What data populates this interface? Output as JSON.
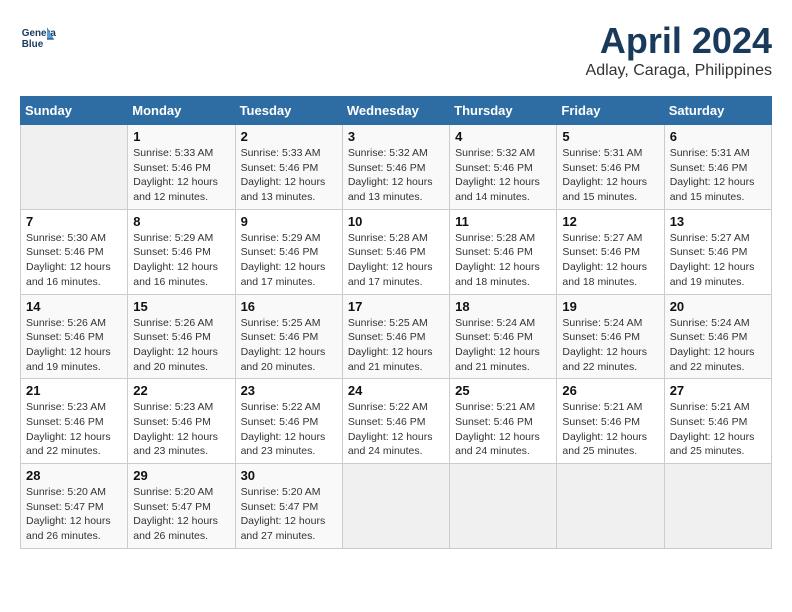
{
  "header": {
    "logo_line1": "General",
    "logo_line2": "Blue",
    "month_year": "April 2024",
    "location": "Adlay, Caraga, Philippines"
  },
  "weekdays": [
    "Sunday",
    "Monday",
    "Tuesday",
    "Wednesday",
    "Thursday",
    "Friday",
    "Saturday"
  ],
  "weeks": [
    [
      {
        "day": null
      },
      {
        "day": "1",
        "sunrise": "5:33 AM",
        "sunset": "5:46 PM",
        "daylight": "12 hours and 12 minutes."
      },
      {
        "day": "2",
        "sunrise": "5:33 AM",
        "sunset": "5:46 PM",
        "daylight": "12 hours and 13 minutes."
      },
      {
        "day": "3",
        "sunrise": "5:32 AM",
        "sunset": "5:46 PM",
        "daylight": "12 hours and 13 minutes."
      },
      {
        "day": "4",
        "sunrise": "5:32 AM",
        "sunset": "5:46 PM",
        "daylight": "12 hours and 14 minutes."
      },
      {
        "day": "5",
        "sunrise": "5:31 AM",
        "sunset": "5:46 PM",
        "daylight": "12 hours and 15 minutes."
      },
      {
        "day": "6",
        "sunrise": "5:31 AM",
        "sunset": "5:46 PM",
        "daylight": "12 hours and 15 minutes."
      }
    ],
    [
      {
        "day": "7",
        "sunrise": "5:30 AM",
        "sunset": "5:46 PM",
        "daylight": "12 hours and 16 minutes."
      },
      {
        "day": "8",
        "sunrise": "5:29 AM",
        "sunset": "5:46 PM",
        "daylight": "12 hours and 16 minutes."
      },
      {
        "day": "9",
        "sunrise": "5:29 AM",
        "sunset": "5:46 PM",
        "daylight": "12 hours and 17 minutes."
      },
      {
        "day": "10",
        "sunrise": "5:28 AM",
        "sunset": "5:46 PM",
        "daylight": "12 hours and 17 minutes."
      },
      {
        "day": "11",
        "sunrise": "5:28 AM",
        "sunset": "5:46 PM",
        "daylight": "12 hours and 18 minutes."
      },
      {
        "day": "12",
        "sunrise": "5:27 AM",
        "sunset": "5:46 PM",
        "daylight": "12 hours and 18 minutes."
      },
      {
        "day": "13",
        "sunrise": "5:27 AM",
        "sunset": "5:46 PM",
        "daylight": "12 hours and 19 minutes."
      }
    ],
    [
      {
        "day": "14",
        "sunrise": "5:26 AM",
        "sunset": "5:46 PM",
        "daylight": "12 hours and 19 minutes."
      },
      {
        "day": "15",
        "sunrise": "5:26 AM",
        "sunset": "5:46 PM",
        "daylight": "12 hours and 20 minutes."
      },
      {
        "day": "16",
        "sunrise": "5:25 AM",
        "sunset": "5:46 PM",
        "daylight": "12 hours and 20 minutes."
      },
      {
        "day": "17",
        "sunrise": "5:25 AM",
        "sunset": "5:46 PM",
        "daylight": "12 hours and 21 minutes."
      },
      {
        "day": "18",
        "sunrise": "5:24 AM",
        "sunset": "5:46 PM",
        "daylight": "12 hours and 21 minutes."
      },
      {
        "day": "19",
        "sunrise": "5:24 AM",
        "sunset": "5:46 PM",
        "daylight": "12 hours and 22 minutes."
      },
      {
        "day": "20",
        "sunrise": "5:24 AM",
        "sunset": "5:46 PM",
        "daylight": "12 hours and 22 minutes."
      }
    ],
    [
      {
        "day": "21",
        "sunrise": "5:23 AM",
        "sunset": "5:46 PM",
        "daylight": "12 hours and 22 minutes."
      },
      {
        "day": "22",
        "sunrise": "5:23 AM",
        "sunset": "5:46 PM",
        "daylight": "12 hours and 23 minutes."
      },
      {
        "day": "23",
        "sunrise": "5:22 AM",
        "sunset": "5:46 PM",
        "daylight": "12 hours and 23 minutes."
      },
      {
        "day": "24",
        "sunrise": "5:22 AM",
        "sunset": "5:46 PM",
        "daylight": "12 hours and 24 minutes."
      },
      {
        "day": "25",
        "sunrise": "5:21 AM",
        "sunset": "5:46 PM",
        "daylight": "12 hours and 24 minutes."
      },
      {
        "day": "26",
        "sunrise": "5:21 AM",
        "sunset": "5:46 PM",
        "daylight": "12 hours and 25 minutes."
      },
      {
        "day": "27",
        "sunrise": "5:21 AM",
        "sunset": "5:46 PM",
        "daylight": "12 hours and 25 minutes."
      }
    ],
    [
      {
        "day": "28",
        "sunrise": "5:20 AM",
        "sunset": "5:47 PM",
        "daylight": "12 hours and 26 minutes."
      },
      {
        "day": "29",
        "sunrise": "5:20 AM",
        "sunset": "5:47 PM",
        "daylight": "12 hours and 26 minutes."
      },
      {
        "day": "30",
        "sunrise": "5:20 AM",
        "sunset": "5:47 PM",
        "daylight": "12 hours and 27 minutes."
      },
      {
        "day": null
      },
      {
        "day": null
      },
      {
        "day": null
      },
      {
        "day": null
      }
    ]
  ],
  "labels": {
    "sunrise": "Sunrise:",
    "sunset": "Sunset:",
    "daylight": "Daylight:"
  }
}
